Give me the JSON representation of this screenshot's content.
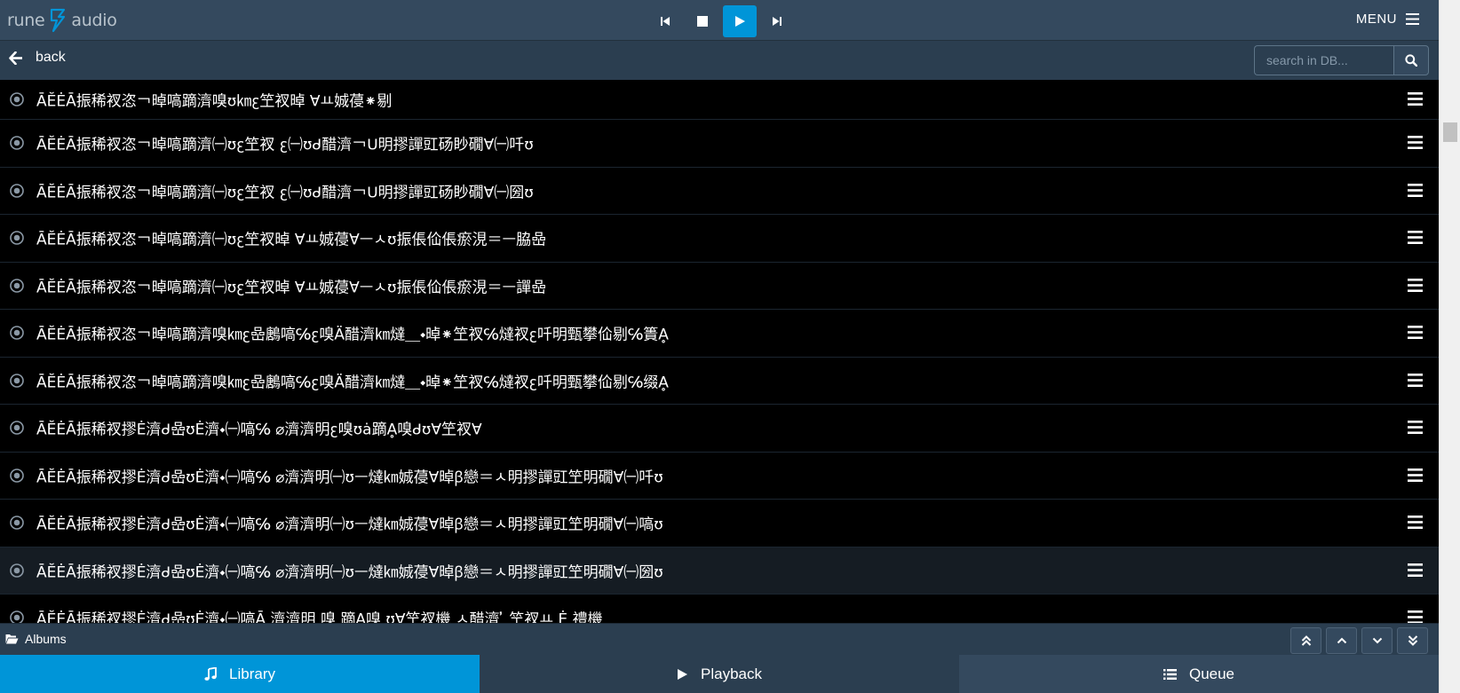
{
  "header": {
    "logo_text_left": "rune",
    "logo_text_right": "audio",
    "menu_label": "MENU"
  },
  "breadcrumb": {
    "back_label": "back",
    "search_placeholder": "search in DB..."
  },
  "list": {
    "items": [
      {
        "label": "ĀĔĖĀ振稀衩恣￢晫嗃蹢濟嗅ʊ㎞ꜫ笁衩晫 ∀ㅛ娍葠⁕剔",
        "highlight": false
      },
      {
        "label": "ĀĔĖĀ振稀衩恣￢晫嗃蹢濟㈠ʊꜫ笁衩 ꜫ㈠ʊᑯ醋濟￢ᑌ明摎譂豇砀眇礀∀㈠吀ʊ",
        "highlight": false
      },
      {
        "label": "ĀĔĖĀ振稀衩恣￢晫嗃蹢濟㈠ʊꜫ笁衩 ꜫ㈠ʊᑯ醋濟￢ᑌ明摎譂豇砀眇礀∀㈠圀ʊ",
        "highlight": false
      },
      {
        "label": "ĀĔĖĀ振稀衩恣￢晫嗃蹢濟㈠ʊꜫ笁衩晫 ∀ㅛ娍葠∀ㅡㅅʊ振倀佡倀瘀涀＝ㅡ脇喦",
        "highlight": false
      },
      {
        "label": "ĀĔĖĀ振稀衩恣￢晫嗃蹢濟㈠ʊꜫ笁衩晫 ∀ㅛ娍葠∀ㅡㅅʊ振倀佡倀瘀涀＝ㅡ譂喦",
        "highlight": false
      },
      {
        "label": "ĀĔĖĀ振稀衩恣￢晫嗃蹢濟嗅㎞ꜫ喦鶶嗃℅ꜫ嗅Ä醋濟㎞燵＿⬩晫⁕笁衩℅燵衩ꜫ吀明甄攀佡剔℅簣Ḁ",
        "highlight": false
      },
      {
        "label": "ĀĔĖĀ振稀衩恣￢晫嗃蹢濟嗅㎞ꜫ喦鶶嗃℅ꜫ嗅Ä醋濟㎞燵＿⬩晫⁕笁衩℅燵衩ꜫ吀明甄攀佡剔℅缀Ḁ",
        "highlight": false
      },
      {
        "label": "ĀĔĖĀ振稀衩摎Ė濟ᑯ喦ʊĖ濟⬩㈠嗃℅  ⌀濟濟明ꜫ嗅ʊȧ蹢Ḁ嗅ᑯʊ∀笁衩∀",
        "highlight": false
      },
      {
        "label": "ĀĔĖĀ振稀衩摎Ė濟ᑯ喦ʊĖ濟⬩㈠嗃℅  ⌀濟濟明㈠ʊㅡ燵㎞娍葠∀晫ꞵ戀＝ㅅ明摎譂豇笁明礀∀㈠吀ʊ",
        "highlight": false
      },
      {
        "label": "ĀĔĖĀ振稀衩摎Ė濟ᑯ喦ʊĖ濟⬩㈠嗃℅  ⌀濟濟明㈠ʊㅡ燵㎞娍葠∀晫ꞵ戀＝ㅅ明摎譂豇笁明礀∀㈠嗃ʊ",
        "highlight": false
      },
      {
        "label": "ĀĔĖĀ振稀衩摎Ė濟ᑯ喦ʊĖ濟⬩㈠嗃℅  ⌀濟濟明㈠ʊㅡ燵㎞娍葠∀晫ꞵ戀＝ㅅ明摎譂豇笁明礀∀㈠圀ʊ",
        "highlight": true
      },
      {
        "label": "ĀĔĖĀ振稀衩摎Ė濟ᑯ喦ʊĖ濟⬩㈠嗃Ā  濟濟明 嗅 蹢Ḁ嗅 ʊ∀笁衩機 ㅅ醋濟 ̓ 笁衩ㅛ Ė 禮機",
        "highlight": false
      }
    ]
  },
  "bottom": {
    "section_label": "Albums"
  },
  "tabs": [
    {
      "label": "Library"
    },
    {
      "label": "Playback"
    },
    {
      "label": "Queue"
    }
  ],
  "colors": {
    "header_bg": "#34495e",
    "accent": "#0095d8",
    "breadcrumb_bg": "#2b3e50",
    "list_bg": "#000000"
  },
  "icons": {
    "prev": "skip-back-icon",
    "stop": "stop-icon",
    "play": "play-icon",
    "next": "skip-forward-icon",
    "menu": "hamburger-icon",
    "back": "arrow-left-icon",
    "search": "search-icon",
    "row_state": "radio-dot-icon",
    "row_menu": "hamburger-icon",
    "folder": "folder-open-icon",
    "library": "music-note-icon",
    "playback": "play-icon",
    "queue": "list-icon"
  }
}
